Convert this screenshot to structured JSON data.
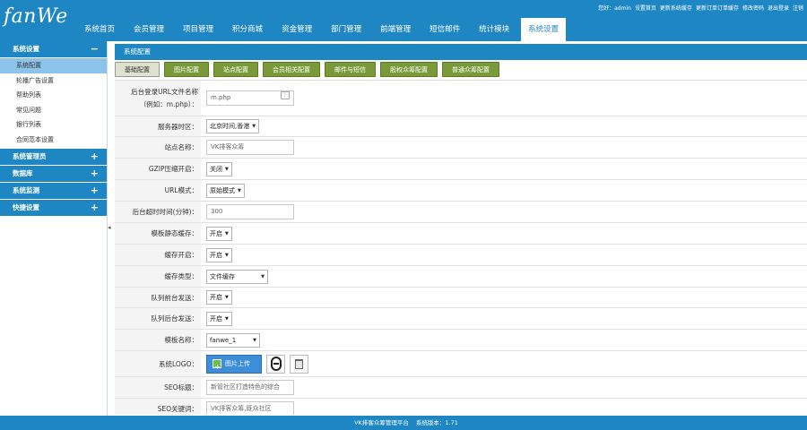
{
  "header": {
    "logo": "fanWe",
    "nav": [
      "系统首页",
      "会员管理",
      "项目管理",
      "积分商城",
      "资金管理",
      "部门管理",
      "前端管理",
      "短信邮件",
      "统计模块",
      "系统设置"
    ],
    "active_nav_index": 9,
    "top_links": [
      "您好：admin",
      "设置首页",
      "更新系统缓存",
      "更新订单订单缓存",
      "修改密码",
      "退出登录",
      "注销"
    ]
  },
  "sidebar": {
    "sections": [
      {
        "title": "系统设置",
        "sign": "−",
        "items": [
          "系统配置",
          "轮播广告设置",
          "帮助列表",
          "常见问题",
          "银行列表",
          "合同范本设置"
        ],
        "active_index": 0
      },
      {
        "title": "系统管理员",
        "sign": "+"
      },
      {
        "title": "数据库",
        "sign": "+"
      },
      {
        "title": "系统监测",
        "sign": "+"
      },
      {
        "title": "快捷设置",
        "sign": "+"
      }
    ]
  },
  "main": {
    "page_title": "系统配置",
    "tabs": [
      "基础配置",
      "图片配置",
      "站点配置",
      "会员相关配置",
      "邮件与短信",
      "股权众筹配置",
      "普通众筹配置"
    ],
    "active_tab_index": 0,
    "form": {
      "admin_file_label_1": "后台登录URL文件名称",
      "admin_file_label_2": "（例如：m.php）：",
      "admin_file_placeholder": "m.php",
      "timezone_label": "服务器时区：",
      "timezone_value": "北京时间,香港",
      "site_name_label": "站点名称：",
      "site_name_value": "VK排客众筹",
      "gzip_label": "GZIP压缩开启：",
      "gzip_value": "关闭",
      "url_mode_label": "URL模式：",
      "url_mode_value": "原始模式",
      "timeout_label": "后台超时时间(分钟)：",
      "timeout_value": "300",
      "tpl_cache_label": "模板静态缓存：",
      "tpl_cache_value": "开启",
      "cache_on_label": "缓存开启：",
      "cache_on_value": "开启",
      "cache_type_label": "缓存类型：",
      "cache_type_value": "文件缓存",
      "queue_front_label": "队列前台发送：",
      "queue_front_value": "开启",
      "queue_back_label": "队列后台发送：",
      "queue_back_value": "开启",
      "template_label": "模板名称：",
      "template_value": "fanwe_1",
      "logo_label": "系统LOGO：",
      "upload_label": "图片上传",
      "seo_title_label": "SEO标题：",
      "seo_title_value": "新管社区打造特色的综合",
      "seo_keywords_label": "SEO关键词：",
      "seo_keywords_value": "VK排客众筹,既众社区"
    }
  },
  "footer": {
    "platform": "VK排客众筹管理平台",
    "version": "系统版本：1.71"
  },
  "colors": {
    "primary": "#1e87c3",
    "tab_green": "#7a9a3a",
    "sidebar_active": "#8bc3ea"
  }
}
